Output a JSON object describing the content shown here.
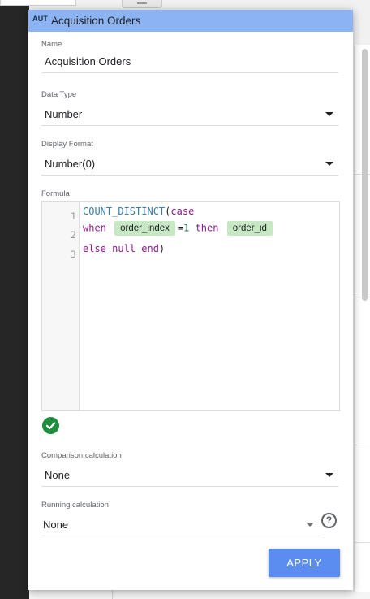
{
  "dialog": {
    "badge": "AUT",
    "title": "Acquisition Orders"
  },
  "fields": {
    "name": {
      "label": "Name",
      "value": "Acquisition Orders"
    },
    "data_type": {
      "label": "Data Type",
      "value": "Number"
    },
    "display_format": {
      "label": "Display Format",
      "value": "Number(0)"
    },
    "formula": {
      "label": "Formula",
      "line_numbers": [
        "1",
        "2",
        "3"
      ],
      "line1": {
        "fn": "COUNT_DISTINCT",
        "paren": "(",
        "kw": "case"
      },
      "line2": {
        "kw1": "when",
        "chip1": "order_index",
        "op": "=",
        "num": "1",
        "kw2": "then",
        "chip2": "order_id"
      },
      "line3": {
        "kw": "else null end",
        "close": ")"
      }
    },
    "comparison": {
      "label": "Comparison calculation",
      "value": "None"
    },
    "running": {
      "label": "Running calculation",
      "value": "None"
    }
  },
  "buttons": {
    "apply": "APPLY"
  },
  "icons": {
    "valid": "check-circle-icon",
    "help": "help-circle-icon",
    "dropdown": "dropdown-arrow-icon"
  },
  "colors": {
    "header": "#8cb4f5",
    "apply": "#5b8cf0",
    "chip": "#c6e9c4",
    "valid": "#1e8e3e"
  }
}
